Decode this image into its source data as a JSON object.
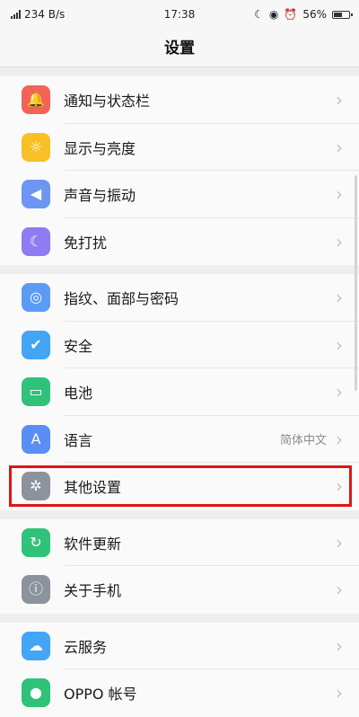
{
  "statusbar": {
    "speed": "234 B/s",
    "time": "17:38",
    "battery": "56%",
    "battery_level": 0.56
  },
  "header": {
    "title": "设置"
  },
  "groups": [
    {
      "items": [
        {
          "label": "通知与状态栏",
          "icon": "bell-icon",
          "color": "#f2645a"
        },
        {
          "label": "显示与亮度",
          "icon": "sun-icon",
          "color": "#f8c024"
        },
        {
          "label": "声音与振动",
          "icon": "speaker-icon",
          "color": "#6d96f3"
        },
        {
          "label": "免打扰",
          "icon": "moon-icon",
          "color": "#8e7cf2"
        }
      ]
    },
    {
      "items": [
        {
          "label": "指纹、面部与密码",
          "icon": "fingerprint-icon",
          "color": "#5a9cf5"
        },
        {
          "label": "安全",
          "icon": "shield-icon",
          "color": "#43a5f5"
        },
        {
          "label": "电池",
          "icon": "battery-icon",
          "color": "#2fc279"
        },
        {
          "label": "语言",
          "icon": "language-icon",
          "color": "#5a8ef5",
          "value": "简体中文"
        },
        {
          "label": "其他设置",
          "icon": "gear-icon",
          "color": "#8c939c",
          "highlighted": true
        }
      ]
    },
    {
      "items": [
        {
          "label": "软件更新",
          "icon": "refresh-icon",
          "color": "#2fc279"
        },
        {
          "label": "关于手机",
          "icon": "info-icon",
          "color": "#8c939c"
        }
      ]
    },
    {
      "items": [
        {
          "label": "云服务",
          "icon": "cloud-icon",
          "color": "#43a5f5"
        },
        {
          "label": "OPPO 帐号",
          "icon": "user-icon",
          "color": "#2fc279"
        }
      ]
    }
  ]
}
